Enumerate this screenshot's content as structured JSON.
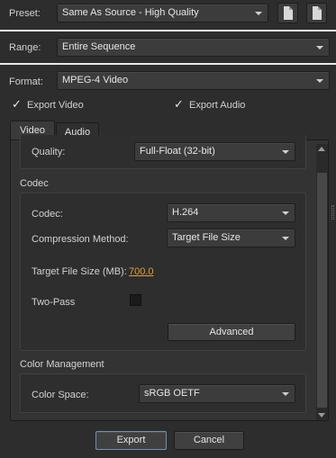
{
  "preset": {
    "label": "Preset:",
    "value": "Same As Source - High Quality"
  },
  "range": {
    "label": "Range:",
    "value": "Entire Sequence"
  },
  "format": {
    "label": "Format:",
    "value": "MPEG-4 Video"
  },
  "export_video": {
    "label": "Export Video",
    "checked": true
  },
  "export_audio": {
    "label": "Export Audio",
    "checked": true
  },
  "tabs": [
    {
      "label": "Video",
      "active": true
    },
    {
      "label": "Audio",
      "active": false
    }
  ],
  "quality": {
    "label": "Quality:",
    "value": "Full-Float (32-bit)"
  },
  "codec_section": {
    "title": "Codec",
    "codec": {
      "label": "Codec:",
      "value": "H.264"
    },
    "compression": {
      "label": "Compression Method:",
      "value": "Target File Size"
    },
    "target_size": {
      "label": "Target File Size (MB):",
      "value": "700.0"
    },
    "two_pass": {
      "label": "Two-Pass",
      "checked": false
    },
    "advanced_label": "Advanced"
  },
  "color_section": {
    "title": "Color Management",
    "color_space": {
      "label": "Color Space:",
      "value": "sRGB OETF"
    }
  },
  "footer": {
    "export_label": "Export",
    "cancel_label": "Cancel"
  },
  "colors": {
    "link": "#e0a030",
    "accent_border": "#6e8fb8"
  }
}
